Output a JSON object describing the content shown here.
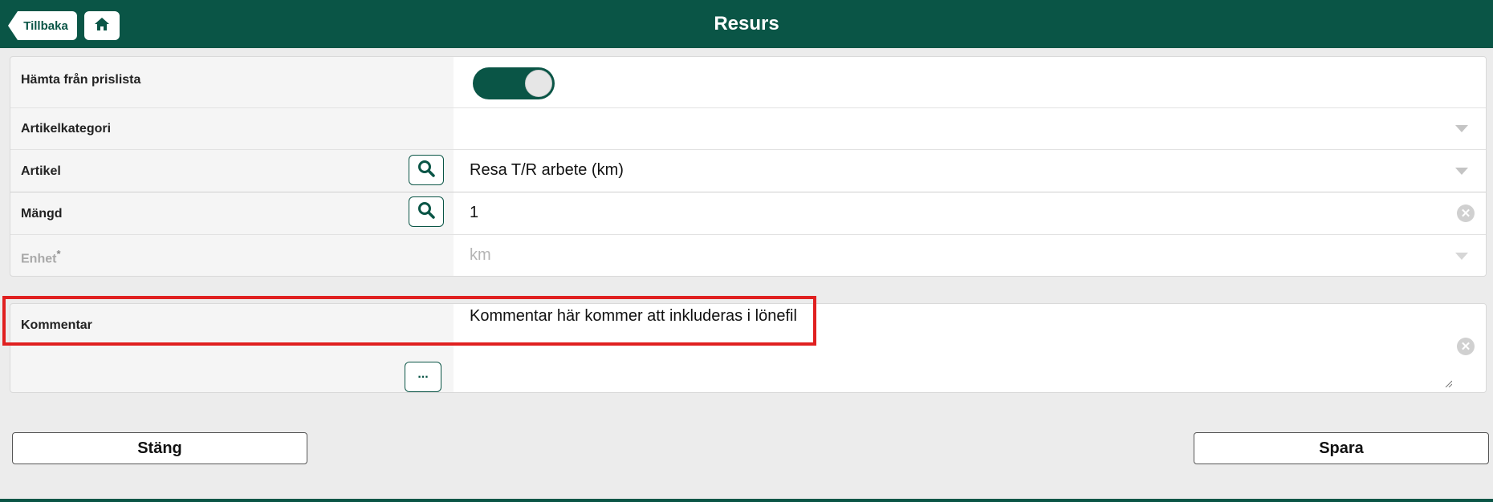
{
  "header": {
    "title": "Resurs",
    "back_label": "Tillbaka",
    "home_icon": "home-icon",
    "background_color": "#0a5546"
  },
  "form": {
    "fetch_from_pricelist": {
      "label": "Hämta från prislista",
      "enabled": true
    },
    "article_category": {
      "label": "Artikelkategori",
      "value": ""
    },
    "article": {
      "label": "Artikel",
      "value": "Resa T/R arbete (km)"
    },
    "quantity": {
      "label": "Mängd",
      "value": "1"
    },
    "unit": {
      "label": "Enhet",
      "required_mark": "*",
      "value": "km"
    }
  },
  "comment": {
    "label": "Kommentar",
    "value": "Kommentar här kommer att inkluderas i lönefil",
    "more_label": "..."
  },
  "actions": {
    "close_label": "Stäng",
    "save_label": "Spara"
  },
  "highlight_color": "#e02020"
}
